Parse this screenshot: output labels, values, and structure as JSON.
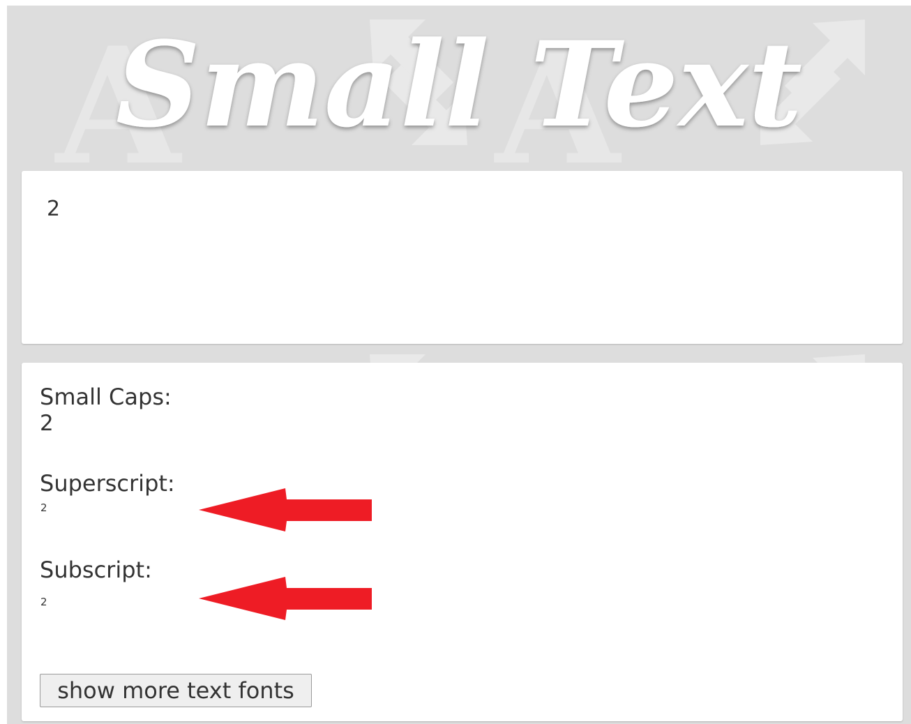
{
  "header": {
    "title": "Small Text"
  },
  "input": {
    "value": "2"
  },
  "output": {
    "small_caps_label": "Small Caps:",
    "small_caps_value": "2",
    "superscript_label": "Superscript:",
    "superscript_value": "2",
    "subscript_label": "Subscript:",
    "subscript_value": "2"
  },
  "more_button_label": "show more text fonts",
  "colors": {
    "page_background": "#dddddd",
    "card_background": "#ffffff",
    "text": "#333333",
    "annotation_arrow": "#ee1c25",
    "header_title": "#ffffff"
  },
  "icons": {
    "background_letters": "letter-a-watermark",
    "background_arrows": "diagonal-resize-arrows-watermark",
    "annotations": "red-pointer-arrow"
  }
}
